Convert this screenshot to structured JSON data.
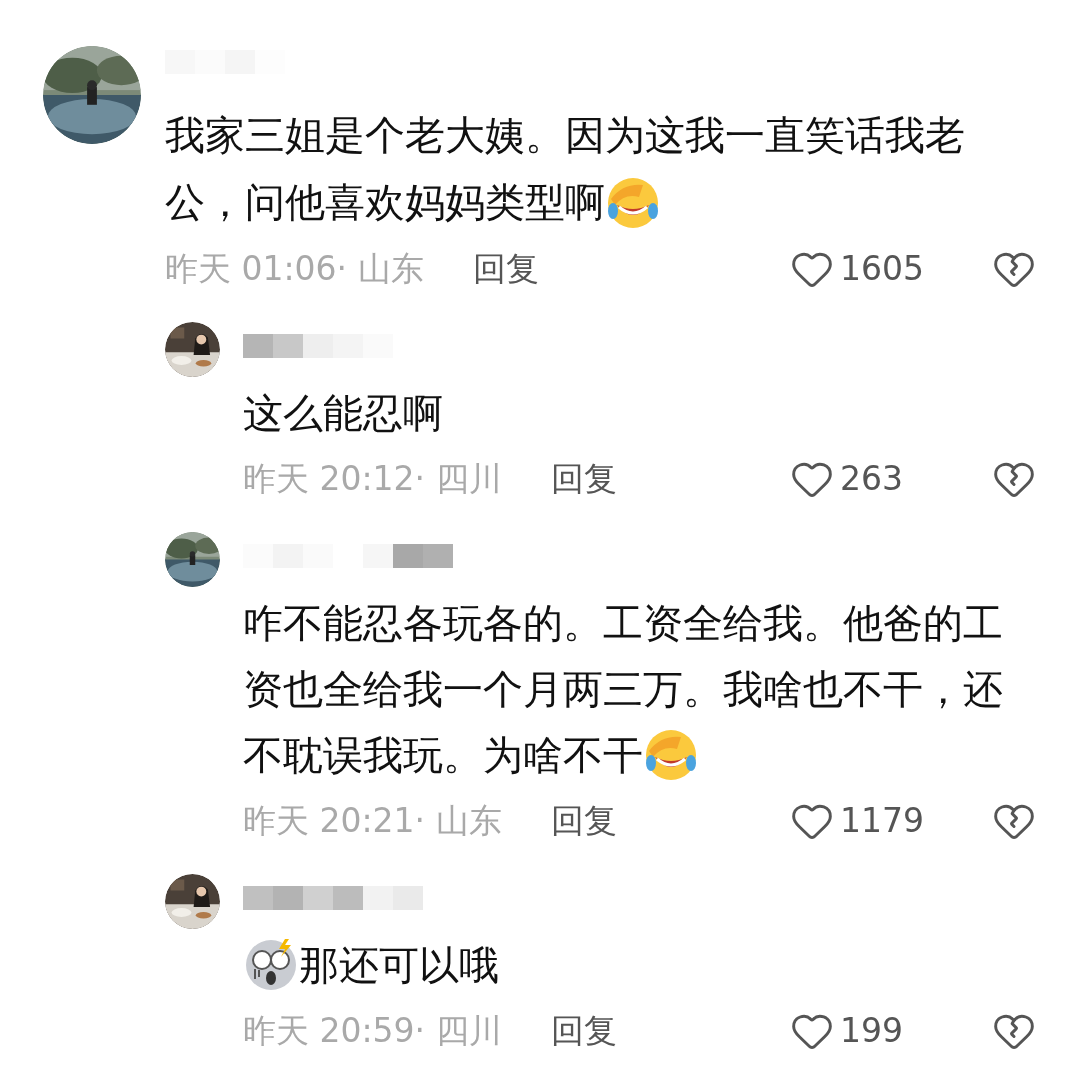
{
  "comments": [
    {
      "lines": [
        [
          {
            "kind": "text",
            "text": "我家三姐是个老大姨。因为这我一直笑话我老"
          }
        ],
        [
          {
            "kind": "text",
            "text": "公，问他喜欢妈妈类型啊"
          },
          {
            "kind": "laughing"
          }
        ]
      ],
      "meta": "昨天 01:06· 山东",
      "reply_label": "回复",
      "likes": "1605",
      "replies": [
        {
          "lines": [
            [
              {
                "kind": "text",
                "text": "这么能忍啊"
              }
            ]
          ],
          "meta": "昨天 20:12· 四川",
          "reply_label": "回复",
          "likes": "263"
        },
        {
          "lines": [
            [
              {
                "kind": "text",
                "text": "咋不能忍各玩各的。工资全给我。他爸的工"
              }
            ],
            [
              {
                "kind": "text",
                "text": "资也全给我一个月两三万。我啥也不干，还"
              }
            ],
            [
              {
                "kind": "text",
                "text": "不耽误我玩。为啥不干"
              },
              {
                "kind": "laughing"
              }
            ]
          ],
          "meta": "昨天 20:21· 山东",
          "reply_label": "回复",
          "likes": "1179"
        },
        {
          "lines": [
            [
              {
                "kind": "screaming"
              },
              {
                "kind": "text",
                "text": "那还可以哦"
              }
            ]
          ],
          "meta": "昨天 20:59· 四川",
          "reply_label": "回复",
          "likes": "199"
        }
      ]
    }
  ]
}
